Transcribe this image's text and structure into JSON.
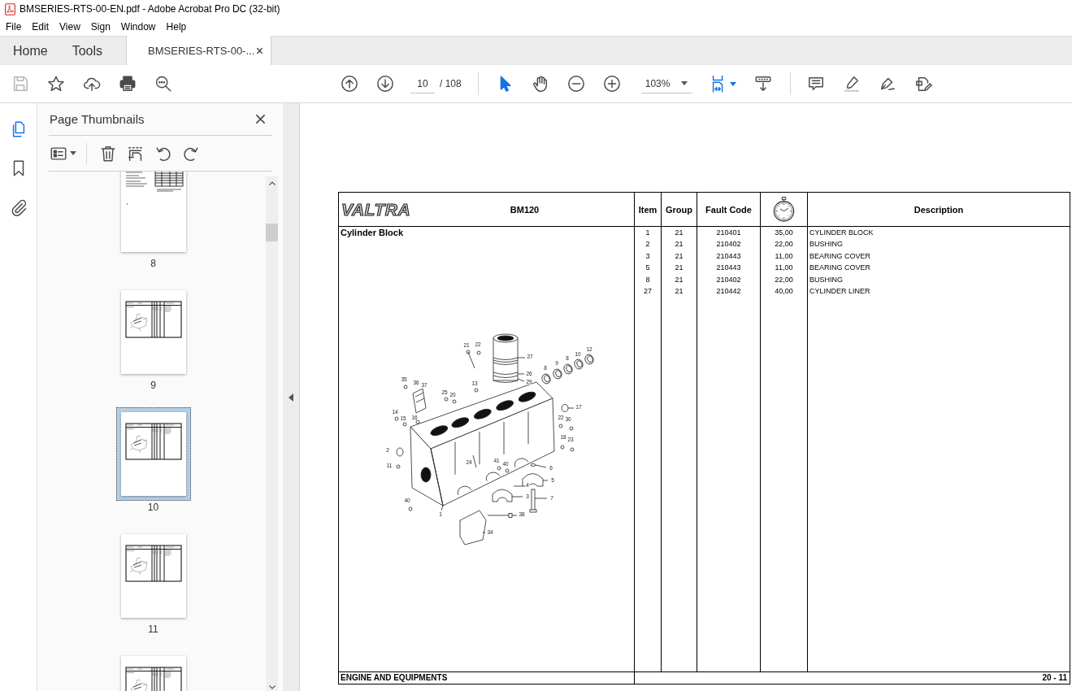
{
  "window": {
    "title": "BMSERIES-RTS-00-EN.pdf - Adobe Acrobat Pro DC (32-bit)"
  },
  "menu": [
    "File",
    "Edit",
    "View",
    "Sign",
    "Window",
    "Help"
  ],
  "tabs": [
    {
      "kind": "nav",
      "label": "Home",
      "selected": false
    },
    {
      "kind": "nav",
      "label": "Tools",
      "selected": false
    },
    {
      "kind": "document",
      "label": "BMSERIES-RTS-00-...",
      "selected": true
    }
  ],
  "toolbar": {
    "save_disabled": true,
    "page_number": "10",
    "page_total": "/ 108",
    "zoom": "103%",
    "pointer_tools": [
      {
        "kind": "select",
        "selected": true
      },
      {
        "kind": "hand",
        "selected": false
      }
    ]
  },
  "side_rail": [
    {
      "kind": "pages",
      "selected": true
    },
    {
      "kind": "bookmarks",
      "selected": false
    },
    {
      "kind": "attachments",
      "selected": false
    }
  ],
  "thumbnails_panel": {
    "title": "Page Thumbnails",
    "pages": [
      {
        "kind": "text_page",
        "label": "8",
        "selected": false
      },
      {
        "kind": "parts_page",
        "label": "9",
        "selected": false
      },
      {
        "kind": "parts_page",
        "label": "10",
        "selected": true
      },
      {
        "kind": "parts_page",
        "label": "11",
        "selected": false
      },
      {
        "kind": "parts_page",
        "selected": false
      }
    ]
  },
  "document": {
    "logo": "VALTRA",
    "model": "BM120",
    "columns": [
      {
        "kind": "text",
        "label": "Item"
      },
      {
        "kind": "text",
        "label": "Group"
      },
      {
        "kind": "text",
        "label": "Fault Code"
      },
      {
        "kind": "timer"
      },
      {
        "kind": "text",
        "label": "Description"
      }
    ],
    "section": "Cylinder Block",
    "rows": [
      [
        "1",
        "21",
        "210401",
        "35,00",
        "CYLINDER BLOCK"
      ],
      [
        "2",
        "21",
        "210402",
        "22,00",
        "BUSHING"
      ],
      [
        "3",
        "21",
        "210443",
        "11,00",
        "BEARING COVER"
      ],
      [
        "5",
        "21",
        "210443",
        "11,00",
        "BEARING COVER"
      ],
      [
        "8",
        "21",
        "210402",
        "22,00",
        "BUSHING"
      ],
      [
        "27",
        "21",
        "210442",
        "40,00",
        "CYLINDER LINER"
      ]
    ],
    "callouts": [
      "21",
      "22",
      "27",
      "12",
      "10",
      "8",
      "9",
      "8",
      "26",
      "29",
      "35",
      "36",
      "37",
      "13",
      "25",
      "20",
      "17",
      "14",
      "15",
      "16",
      "22",
      "30",
      "2",
      "18",
      "23",
      "11",
      "24",
      "41",
      "40",
      "6",
      "5",
      "4",
      "3",
      "7",
      "40",
      "1",
      "38",
      "34"
    ],
    "footer": {
      "chapter": "ENGINE AND EQUIPMENTS",
      "page": "20 - 11"
    }
  }
}
